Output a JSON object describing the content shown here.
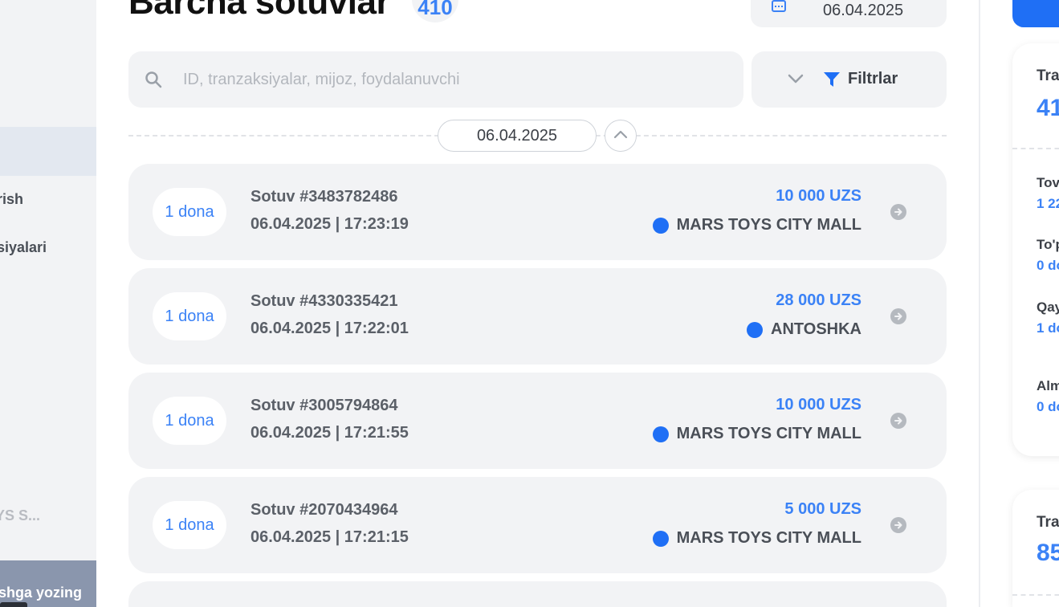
{
  "sidebar": {
    "items": [
      {
        "label": "rish"
      },
      {
        "label": "siyalari"
      }
    ],
    "store_name": "YS S...",
    "support_text": "shga yozing"
  },
  "header": {
    "title": "Barcha sotuvlar",
    "count": "410",
    "date": "06.04.2025"
  },
  "search": {
    "placeholder": "ID, tranzaksiyalar, mijoz, foydalanuvchi",
    "value": ""
  },
  "filter": {
    "label": "Filtrlar"
  },
  "date_group": {
    "date": "06.04.2025"
  },
  "sales": [
    {
      "qty": "1 dona",
      "id": "Sotuv #3483782486",
      "datetime": "06.04.2025 | 17:23:19",
      "amount": "10 000 UZS",
      "store": "MARS TOYS CITY MALL"
    },
    {
      "qty": "1 dona",
      "id": "Sotuv #4330335421",
      "datetime": "06.04.2025 | 17:22:01",
      "amount": "28 000 UZS",
      "store": "ANTOSHKA"
    },
    {
      "qty": "1 dona",
      "id": "Sotuv #3005794864",
      "datetime": "06.04.2025 | 17:21:55",
      "amount": "10 000 UZS",
      "store": "MARS TOYS CITY MALL"
    },
    {
      "qty": "1 dona",
      "id": "Sotuv #2070434964",
      "datetime": "06.04.2025 | 17:21:15",
      "amount": "5 000 UZS",
      "store": "MARS TOYS CITY MALL"
    }
  ],
  "stats": {
    "card1": {
      "title": "Tra",
      "value": "41",
      "rows": [
        {
          "label": "Tov",
          "value": "1 22"
        },
        {
          "label": "To'p",
          "value": "0 do"
        },
        {
          "label": "Qay",
          "value": "1 do"
        },
        {
          "label": "Alm",
          "value": "0 do"
        }
      ]
    },
    "card2": {
      "title": "Tra",
      "value": "85"
    }
  },
  "colors": {
    "accent": "#3b82f6",
    "brand_blue": "#1f6ff5",
    "card_bg": "#f2f3f5"
  }
}
